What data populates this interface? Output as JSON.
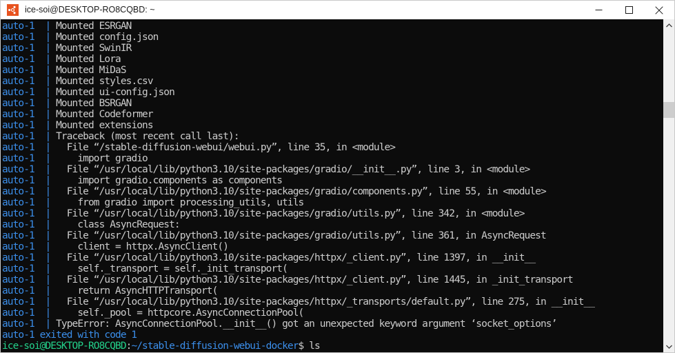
{
  "window": {
    "title": "ice-soi@DESKTOP-RO8CQBD: ~",
    "icon": "ubuntu-icon",
    "controls": {
      "minimize": "minimize-button",
      "maximize": "maximize-button",
      "close": "close-button"
    }
  },
  "terminal": {
    "background": "#0c0c0c",
    "foreground": "#cccccc",
    "service_color": "#3b8eea",
    "prompt_user_color": "#23d18b",
    "prompt_path_color": "#3b8eea",
    "service_name": "auto-1",
    "separator": "|",
    "lines": [
      {
        "type": "log",
        "service": "auto-1",
        "text": "Mounted ESRGAN"
      },
      {
        "type": "log",
        "service": "auto-1",
        "text": "Mounted config.json"
      },
      {
        "type": "log",
        "service": "auto-1",
        "text": "Mounted SwinIR"
      },
      {
        "type": "log",
        "service": "auto-1",
        "text": "Mounted Lora"
      },
      {
        "type": "log",
        "service": "auto-1",
        "text": "Mounted MiDaS"
      },
      {
        "type": "log",
        "service": "auto-1",
        "text": "Mounted styles.csv"
      },
      {
        "type": "log",
        "service": "auto-1",
        "text": "Mounted ui-config.json"
      },
      {
        "type": "log",
        "service": "auto-1",
        "text": "Mounted BSRGAN"
      },
      {
        "type": "log",
        "service": "auto-1",
        "text": "Mounted Codeformer"
      },
      {
        "type": "log",
        "service": "auto-1",
        "text": "Mounted extensions"
      },
      {
        "type": "log",
        "service": "auto-1",
        "text": "Traceback (most recent call last):"
      },
      {
        "type": "log",
        "service": "auto-1",
        "text": "  File “/stable-diffusion-webui/webui.py”, line 35, in <module>"
      },
      {
        "type": "log",
        "service": "auto-1",
        "text": "    import gradio"
      },
      {
        "type": "log",
        "service": "auto-1",
        "text": "  File “/usr/local/lib/python3.10/site-packages/gradio/__init__.py”, line 3, in <module>"
      },
      {
        "type": "log",
        "service": "auto-1",
        "text": "    import gradio.components as components"
      },
      {
        "type": "log",
        "service": "auto-1",
        "text": "  File “/usr/local/lib/python3.10/site-packages/gradio/components.py”, line 55, in <module>"
      },
      {
        "type": "log",
        "service": "auto-1",
        "text": "    from gradio import processing_utils, utils"
      },
      {
        "type": "log",
        "service": "auto-1",
        "text": "  File “/usr/local/lib/python3.10/site-packages/gradio/utils.py”, line 342, in <module>"
      },
      {
        "type": "log",
        "service": "auto-1",
        "text": "    class AsyncRequest:"
      },
      {
        "type": "log",
        "service": "auto-1",
        "text": "  File “/usr/local/lib/python3.10/site-packages/gradio/utils.py”, line 361, in AsyncRequest"
      },
      {
        "type": "log",
        "service": "auto-1",
        "text": "    client = httpx.AsyncClient()"
      },
      {
        "type": "log",
        "service": "auto-1",
        "text": "  File “/usr/local/lib/python3.10/site-packages/httpx/_client.py”, line 1397, in __init__"
      },
      {
        "type": "log",
        "service": "auto-1",
        "text": "    self._transport = self._init_transport("
      },
      {
        "type": "log",
        "service": "auto-1",
        "text": "  File “/usr/local/lib/python3.10/site-packages/httpx/_client.py”, line 1445, in _init_transport"
      },
      {
        "type": "log",
        "service": "auto-1",
        "text": "    return AsyncHTTPTransport("
      },
      {
        "type": "log",
        "service": "auto-1",
        "text": "  File “/usr/local/lib/python3.10/site-packages/httpx/_transports/default.py”, line 275, in __init__"
      },
      {
        "type": "log",
        "service": "auto-1",
        "text": "    self._pool = httpcore.AsyncConnectionPool("
      },
      {
        "type": "log",
        "service": "auto-1",
        "text": "TypeError: AsyncConnectionPool.__init__() got an unexpected keyword argument ‘socket_options’"
      },
      {
        "type": "exit",
        "text": "auto-1 exited with code 1"
      },
      {
        "type": "prompt",
        "user": "ice-soi@DESKTOP-RO8CQBD",
        "punct": ":",
        "path": "~/stable-diffusion-webui-docker",
        "dollar": "$ ",
        "command": "ls"
      }
    ]
  },
  "scrollbar": {
    "up_arrow": "scroll-up-arrow-icon",
    "down_arrow": "scroll-down-arrow-icon",
    "thumb_top_pct": 23,
    "thumb_height_pct": 5
  }
}
